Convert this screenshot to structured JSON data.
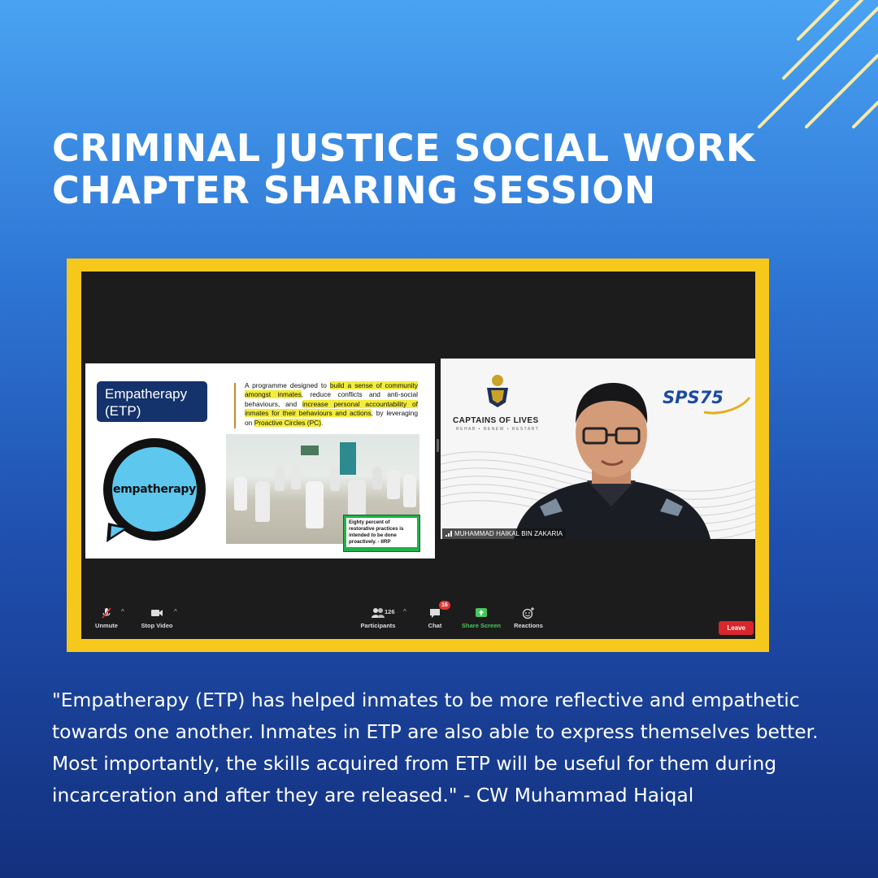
{
  "title": {
    "line1": "CRIMINAL JUSTICE SOCIAL WORK",
    "line2": "CHAPTER SHARING SESSION"
  },
  "slide": {
    "etp_line1": "Empatherapy",
    "etp_line2": "(ETP)",
    "logo_text": "empatherapy",
    "desc_p1": "A programme designed to ",
    "desc_hl1": "build a sense of community amongst inmates",
    "desc_p2": ", reduce conflicts and anti-social behaviours, and ",
    "desc_hl2": "increase personal accountability of inmates for their behaviours and actions",
    "desc_p3": ", by leveraging on ",
    "desc_hl3": "Proactive Circles (PC)",
    "desc_p4": ".",
    "green_box": "Eighty percent of restorative practices is intended to be done proactively. - IIRP"
  },
  "speaker": {
    "org_name": "CAPTAINS OF LIVES",
    "org_tagline": "REHAB • RENEW • RESTART",
    "sps_logo": "SPS",
    "sps_number": "75",
    "name_tag": "MUHAMMAD HAIKAL BIN ZAKARIA"
  },
  "toolbar": {
    "unmute": "Unmute",
    "stop_video": "Stop Video",
    "participants": "Participants",
    "participant_count": "126",
    "chat": "Chat",
    "chat_badge": "16",
    "share_screen": "Share Screen",
    "reactions": "Reactions",
    "leave": "Leave"
  },
  "quote": "\"Empatherapy (ETP) has helped inmates to be more reflective and empathetic towards one another. Inmates in ETP are also able to express themselves better. Most importantly, the skills acquired from ETP will be useful for them during incarceration and after they are released.\" - CW Muhammad Haiqal",
  "colors": {
    "frame": "#f7c81c",
    "highlight": "#f2ec3a",
    "leave_button": "#d9262c",
    "share_screen": "#45c95a"
  }
}
